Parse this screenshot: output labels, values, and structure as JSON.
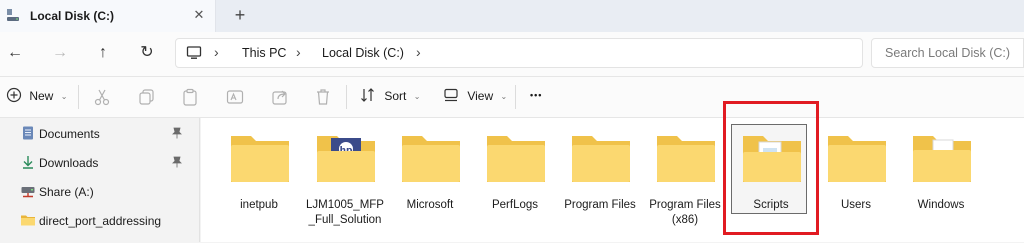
{
  "window": {
    "tab_title": "Local Disk (C:)",
    "close_glyph": "✕",
    "new_tab_glyph": "+"
  },
  "nav": {
    "back_glyph": "←",
    "forward_glyph": "→",
    "up_glyph": "↑",
    "refresh_glyph": "↻",
    "breadcrumb": [
      "This PC",
      "Local Disk (C:)"
    ],
    "sep_glyph": "›",
    "search_placeholder": "Search Local Disk (C:)"
  },
  "command_bar": {
    "new_label": "New",
    "sort_label": "Sort",
    "view_label": "View",
    "more_glyph": "•••",
    "chevron": "⌄"
  },
  "sidebar": {
    "items": [
      {
        "label": "Documents",
        "icon": "documents-icon",
        "pinned": true
      },
      {
        "label": "Downloads",
        "icon": "download-icon",
        "pinned": true
      },
      {
        "label": "Share (A:)",
        "icon": "network-drive-icon",
        "pinned": false
      },
      {
        "label": "direct_port_addressing",
        "icon": "folder-icon",
        "pinned": false
      }
    ],
    "pin_glyph": "📌"
  },
  "folders": [
    {
      "name": "inetpub",
      "icon": "folder-icon"
    },
    {
      "name": "LJM1005_MFP_Full_Solution",
      "icon": "hp-folder-icon"
    },
    {
      "name": "Microsoft",
      "icon": "folder-icon"
    },
    {
      "name": "PerfLogs",
      "icon": "folder-icon"
    },
    {
      "name": "Program Files",
      "icon": "folder-icon"
    },
    {
      "name": "Program Files (x86)",
      "icon": "folder-icon"
    },
    {
      "name": "Scripts",
      "icon": "folder-with-files-icon",
      "selected": true
    },
    {
      "name": "Users",
      "icon": "folder-icon"
    },
    {
      "name": "Windows",
      "icon": "folder-with-files-icon"
    }
  ],
  "colors": {
    "folder_back": "#f0c24a",
    "folder_front": "#fbd870",
    "highlight": "#e11b22",
    "accent": "#0067c0"
  }
}
